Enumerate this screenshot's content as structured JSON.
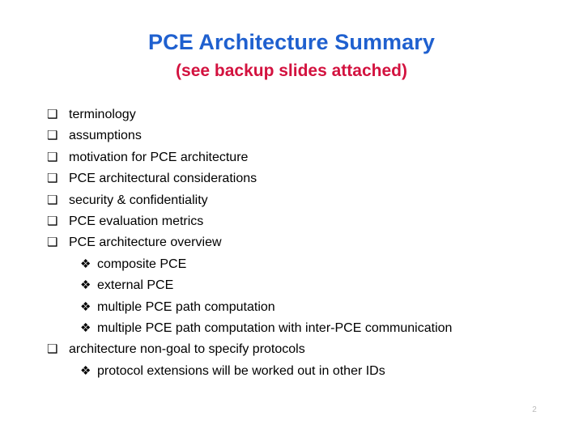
{
  "slide": {
    "title": "PCE Architecture Summary",
    "subtitle": "(see backup slides attached)",
    "title_color": "#1f60cf",
    "subtitle_color": "#d3123f",
    "background_color": "#ffffff",
    "slide_number": "2",
    "markers": {
      "level1": "❑",
      "level2": "❖"
    },
    "bullets": [
      {
        "level": 1,
        "text": "terminology"
      },
      {
        "level": 1,
        "text": "assumptions"
      },
      {
        "level": 1,
        "text": "motivation for PCE architecture"
      },
      {
        "level": 1,
        "text": "PCE architectural considerations"
      },
      {
        "level": 1,
        "text": "security & confidentiality"
      },
      {
        "level": 1,
        "text": "PCE evaluation metrics"
      },
      {
        "level": 1,
        "text": "PCE architecture overview"
      },
      {
        "level": 2,
        "text": "composite PCE"
      },
      {
        "level": 2,
        "text": "external PCE"
      },
      {
        "level": 2,
        "text": "multiple PCE path computation"
      },
      {
        "level": 2,
        "text": "multiple PCE path computation with inter-PCE communication"
      },
      {
        "level": 1,
        "text": "architecture non-goal to specify protocols"
      },
      {
        "level": 2,
        "text": "protocol extensions will be worked out in other IDs"
      }
    ]
  }
}
